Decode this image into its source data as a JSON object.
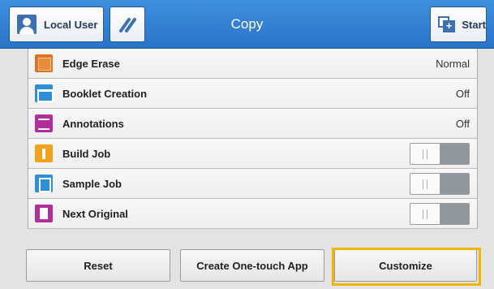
{
  "header": {
    "title": "Copy",
    "user_label": "Local User",
    "start_label": "Start"
  },
  "settings": [
    {
      "label": "Edge Erase",
      "value": "Normal",
      "icon": "edge-erase-icon",
      "control": "value"
    },
    {
      "label": "Booklet Creation",
      "value": "Off",
      "icon": "booklet-icon",
      "control": "value"
    },
    {
      "label": "Annotations",
      "value": "Off",
      "icon": "annotations-icon",
      "control": "value"
    },
    {
      "label": "Build Job",
      "icon": "build-job-icon",
      "control": "toggle",
      "state": "off"
    },
    {
      "label": "Sample Job",
      "icon": "sample-job-icon",
      "control": "toggle",
      "state": "off"
    },
    {
      "label": "Next Original",
      "icon": "next-original-icon",
      "control": "toggle",
      "state": "off"
    }
  ],
  "buttons": {
    "reset": "Reset",
    "one_touch": "Create One-touch App",
    "customize": "Customize"
  },
  "colors": {
    "header": "#2f7fd6",
    "highlight": "#f4b400"
  }
}
